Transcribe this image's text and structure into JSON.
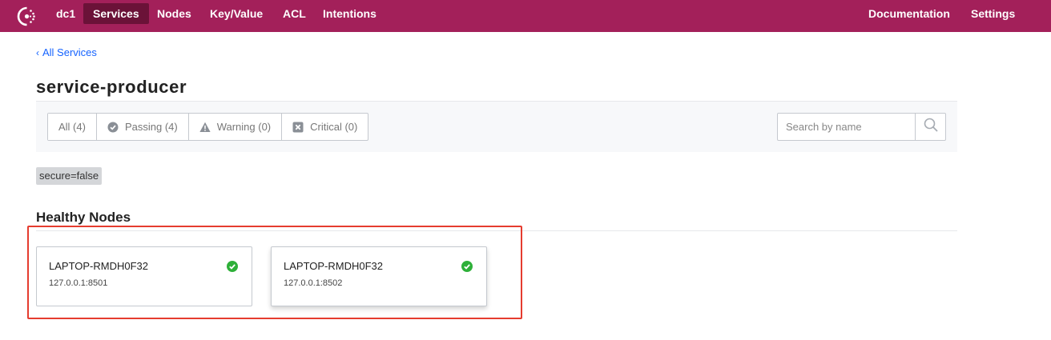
{
  "nav": {
    "datacenter": "dc1",
    "items": [
      {
        "label": "Services",
        "active": true
      },
      {
        "label": "Nodes"
      },
      {
        "label": "Key/Value"
      },
      {
        "label": "ACL"
      },
      {
        "label": "Intentions"
      }
    ],
    "right": [
      {
        "label": "Documentation"
      },
      {
        "label": "Settings"
      }
    ],
    "brand_color": "#a3205a"
  },
  "breadcrumb": {
    "label": "All Services"
  },
  "page": {
    "title": "service-producer"
  },
  "filters": {
    "items": [
      {
        "label": "All (4)",
        "icon": null
      },
      {
        "label": "Passing (4)",
        "icon": "check-circle-icon"
      },
      {
        "label": "Warning (0)",
        "icon": "warning-triangle-icon"
      },
      {
        "label": "Critical (0)",
        "icon": "x-square-icon"
      }
    ]
  },
  "search": {
    "placeholder": "Search by name",
    "value": ""
  },
  "tags": [
    "secure=false"
  ],
  "healthy": {
    "title": "Healthy Nodes",
    "nodes": [
      {
        "name": "LAPTOP-RMDH0F32",
        "address": "127.0.0.1:8501",
        "status": "passing"
      },
      {
        "name": "LAPTOP-RMDH0F32",
        "address": "127.0.0.1:8502",
        "status": "passing"
      }
    ]
  },
  "colors": {
    "passing": "#2eb039",
    "link": "#1563ff",
    "highlight": "#e53c2f"
  }
}
